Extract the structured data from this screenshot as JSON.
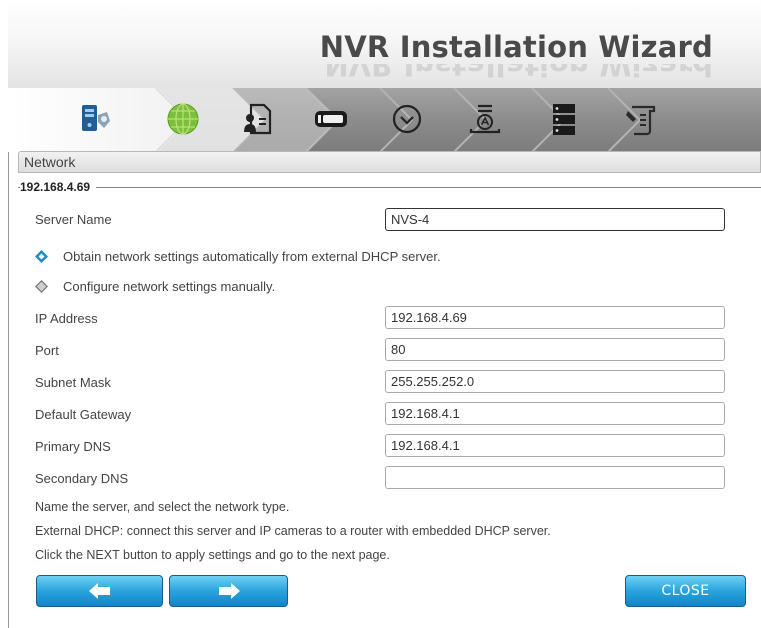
{
  "wizard": {
    "title": "NVR Installation Wizard"
  },
  "steps": [
    {
      "icon": "server-shield-icon"
    },
    {
      "icon": "globe-icon"
    },
    {
      "icon": "user-document-icon"
    },
    {
      "icon": "storage-drive-icon"
    },
    {
      "icon": "clock-icon"
    },
    {
      "icon": "driver-install-icon"
    },
    {
      "icon": "server-rack-icon"
    },
    {
      "icon": "wrench-document-icon"
    }
  ],
  "section": {
    "title": "Network",
    "group_label": "192.168.4.69"
  },
  "form": {
    "server_name_label": "Server Name",
    "server_name_value": "NVS-4",
    "dhcp_option": "Obtain network settings automatically from external DHCP server.",
    "manual_option": "Configure network settings manually.",
    "selected_option": "dhcp",
    "ip_label": "IP Address",
    "ip_value": "192.168.4.69",
    "port_label": "Port",
    "port_value": "80",
    "subnet_label": "Subnet Mask",
    "subnet_value": "255.255.252.0",
    "gateway_label": "Default Gateway",
    "gateway_value": "192.168.4.1",
    "primary_dns_label": "Primary DNS",
    "primary_dns_value": "192.168.4.1",
    "secondary_dns_label": "Secondary DNS",
    "secondary_dns_value": ""
  },
  "notes": [
    "Name the server, and select the network type.",
    "External DHCP: connect this server and IP cameras to a router with embedded DHCP server.",
    "Click the NEXT button to apply settings and go to the next page."
  ],
  "buttons": {
    "back_icon": "arrow-left-icon",
    "next_icon": "arrow-right-icon",
    "close_label": "CLOSE"
  },
  "colors": {
    "accent_blue": "#2aa3dd",
    "step_bar_gray": "#8e8e8e"
  }
}
